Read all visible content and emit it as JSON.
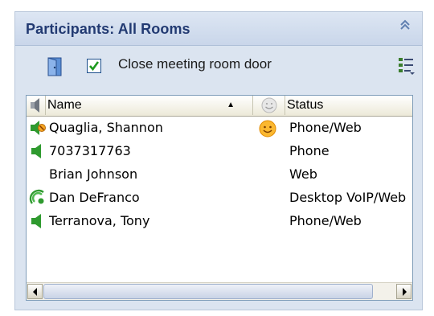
{
  "panel": {
    "title": "Participants: All Rooms",
    "collapse_icon": "double-chevron-up-icon"
  },
  "toolbar": {
    "door_icon": "door-icon",
    "close_door_checked": true,
    "close_door_label": "Close meeting room door",
    "view_options_icon": "list-options-icon"
  },
  "table": {
    "columns": {
      "audio_icon": "speaker-icon",
      "name": "Name",
      "sort": "ascending",
      "mood_icon": "smiley-icon",
      "status": "Status"
    },
    "rows": [
      {
        "audio": "speaker-muted-icon",
        "name": "Quaglia, Shannon",
        "mood": "smiley-icon",
        "status": "Phone/Web"
      },
      {
        "audio": "speaker-icon",
        "name": "7037317763",
        "mood": "",
        "status": "Phone"
      },
      {
        "audio": "",
        "name": "Brian Johnson",
        "mood": "",
        "status": "Web"
      },
      {
        "audio": "voip-speaking-icon",
        "name": "Dan DeFranco",
        "mood": "",
        "status": "Desktop VoIP/Web"
      },
      {
        "audio": "speaker-icon",
        "name": "Terranova, Tony",
        "mood": "",
        "status": "Phone/Web"
      }
    ]
  },
  "colors": {
    "title": "#223a72",
    "panel_bg": "#dbe4f0",
    "speaker_green": "#2f9a2f",
    "check_green": "#1e9a1e"
  }
}
